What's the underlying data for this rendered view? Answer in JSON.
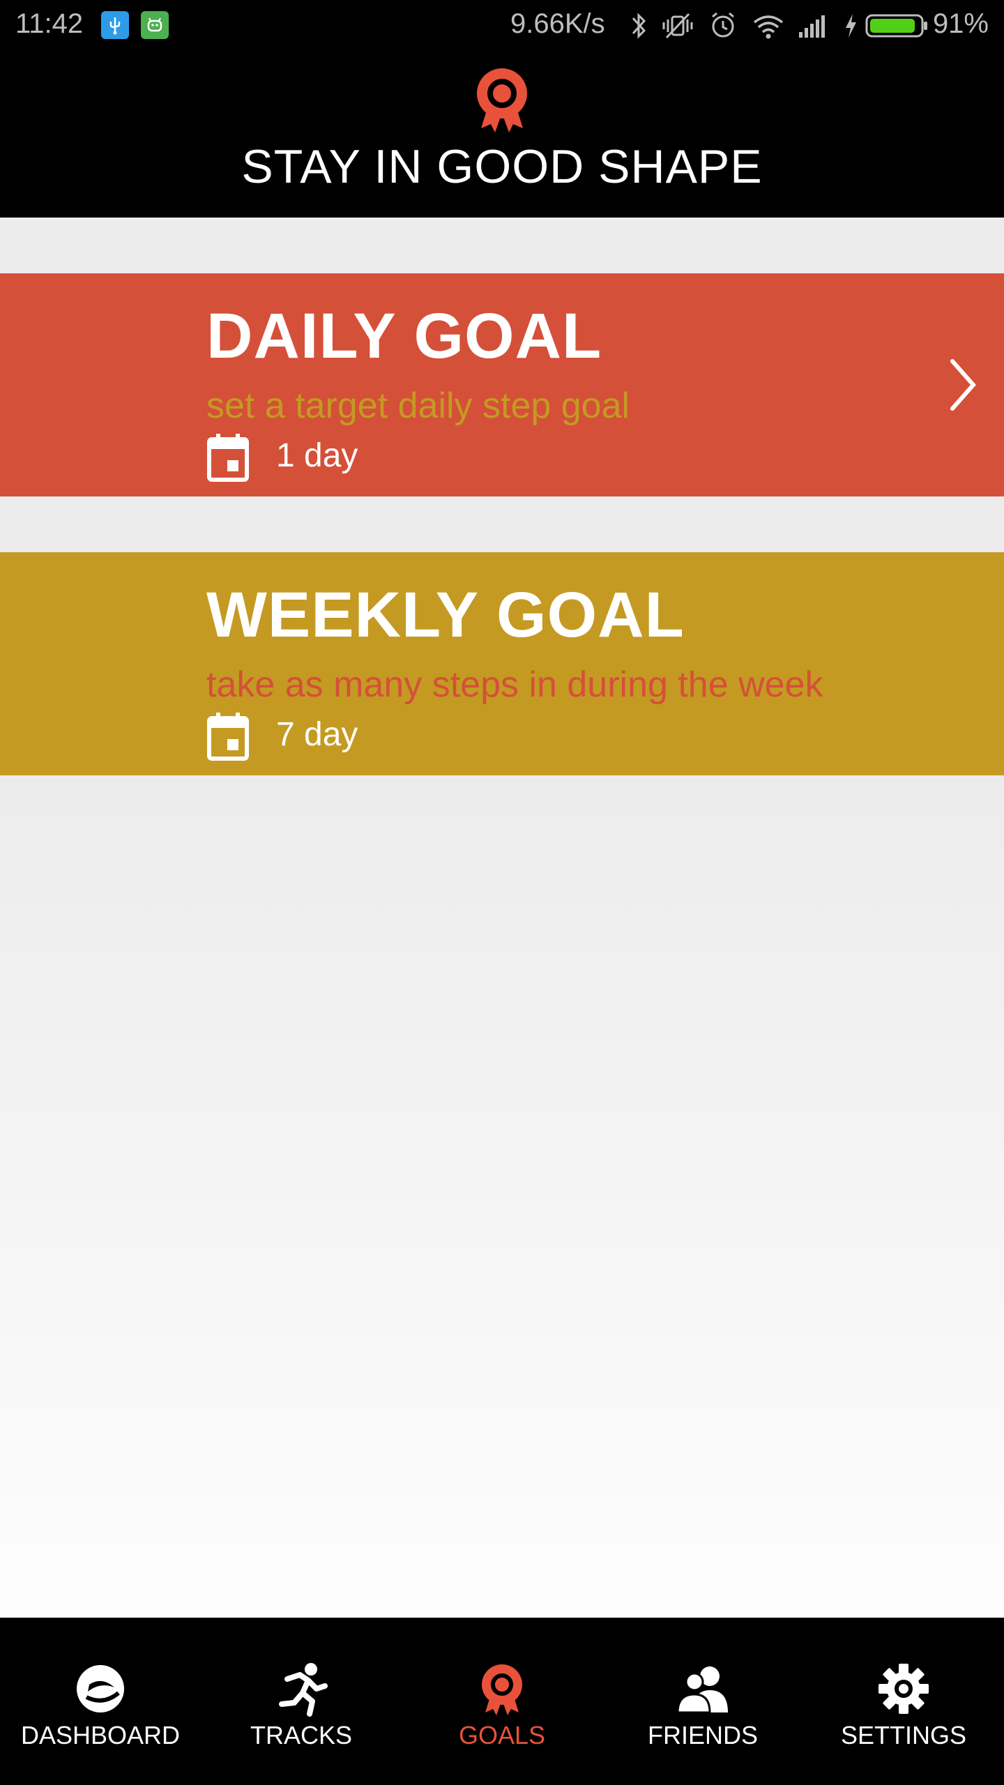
{
  "status_bar": {
    "time": "11:42",
    "net_speed": "9.66K/s",
    "battery_percent": "91%",
    "battery_level": 0.91,
    "icons": [
      "usb-icon",
      "android-icon",
      "bluetooth-icon",
      "vibrate-icon",
      "alarm-icon",
      "wifi-icon",
      "signal-icon",
      "charging-icon",
      "battery-icon"
    ]
  },
  "header": {
    "icon": "ribbon-badge-icon",
    "title": "STAY IN GOOD SHAPE"
  },
  "goals": [
    {
      "title": "DAILY GOAL",
      "description": "set a target daily step goal",
      "duration": "1 day",
      "color": "#d55038",
      "description_color": "#c49a22",
      "icon": "calendar-icon",
      "action_icon": "chevron-right-icon"
    },
    {
      "title": "WEEKLY GOAL",
      "description": "take as many steps in during the week",
      "duration": "7 day",
      "color": "#c49a22",
      "description_color": "#d55038",
      "icon": "calendar-icon"
    }
  ],
  "bottom_nav": {
    "items": [
      {
        "label": "DASHBOARD",
        "icon": "dashboard-icon",
        "active": false
      },
      {
        "label": "TRACKS",
        "icon": "running-icon",
        "active": false
      },
      {
        "label": "GOALS",
        "icon": "ribbon-badge-icon",
        "active": true
      },
      {
        "label": "FRIENDS",
        "icon": "friends-icon",
        "active": false
      },
      {
        "label": "SETTINGS",
        "icon": "gear-icon",
        "active": false
      }
    ],
    "active_color": "#e8523a"
  }
}
